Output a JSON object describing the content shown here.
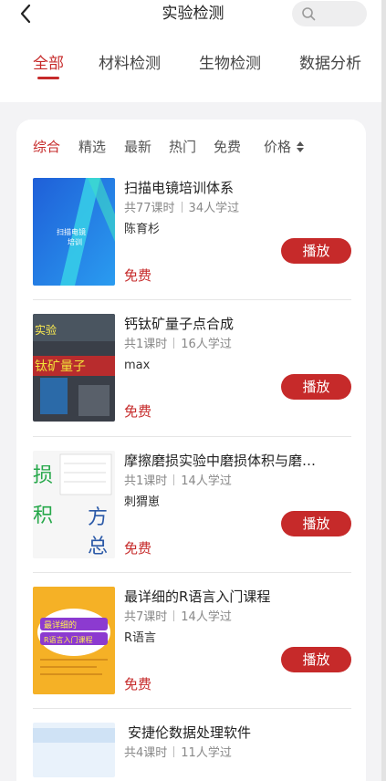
{
  "header": {
    "title": "实验检测",
    "back_icon": "chevron-left-icon",
    "search_icon": "search-icon"
  },
  "tabs": [
    {
      "label": "全部",
      "active": true
    },
    {
      "label": "材料检测",
      "active": false
    },
    {
      "label": "生物检测",
      "active": false
    },
    {
      "label": "数据分析",
      "active": false
    }
  ],
  "filters": [
    {
      "label": "综合",
      "active": true
    },
    {
      "label": "精选",
      "active": false
    },
    {
      "label": "最新",
      "active": false
    },
    {
      "label": "热门",
      "active": false
    },
    {
      "label": "免费",
      "active": false
    },
    {
      "label": "价格",
      "active": false
    }
  ],
  "courses": [
    {
      "title": "扫描电镜培训体系",
      "lessons": "共77课时",
      "learners": "34人学过",
      "author": "陈育杉",
      "price": "免费",
      "play_label": "播放",
      "thumb_text": "扫描电镜\n培训"
    },
    {
      "title": "钙钛矿量子点合成",
      "lessons": "共1课时",
      "learners": "16人学过",
      "author": "max",
      "price": "免费",
      "play_label": "播放",
      "thumb_text": "钛矿量子"
    },
    {
      "title": "摩擦磨损实验中磨损体积与磨…",
      "lessons": "共1课时",
      "learners": "14人学过",
      "author": "刺猬崽",
      "price": "免费",
      "play_label": "播放",
      "thumb_text": "损 方"
    },
    {
      "title": "最详细的R语言入门课程",
      "lessons": "共7课时",
      "learners": "14人学过",
      "author": "R语言",
      "price": "免费",
      "play_label": "播放",
      "thumb_text": "最详细的R语言入门课程"
    },
    {
      "title": "安捷伦数据处理软件",
      "lessons": "共4课时",
      "learners": "11人学过"
    }
  ],
  "colors": {
    "accent": "#c62a2a",
    "background": "#f3f3f5",
    "card": "#ffffff"
  }
}
